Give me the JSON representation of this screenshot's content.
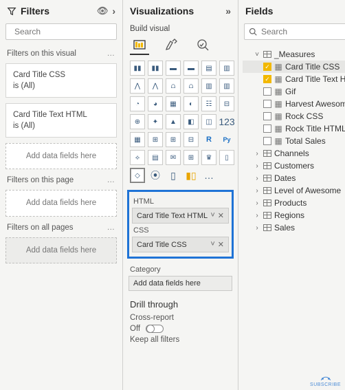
{
  "filters": {
    "title": "Filters",
    "search_placeholder": "Search",
    "sections": {
      "visual": {
        "label": "Filters on this visual",
        "cards": [
          {
            "name": "Card Title CSS",
            "summary": "is (All)"
          },
          {
            "name": "Card Title Text HTML",
            "summary": "is (All)"
          }
        ],
        "add_placeholder": "Add data fields here"
      },
      "page": {
        "label": "Filters on this page",
        "add_placeholder": "Add data fields here"
      },
      "all": {
        "label": "Filters on all pages",
        "add_placeholder": "Add data fields here"
      }
    }
  },
  "viz": {
    "title": "Visualizations",
    "build_label": "Build visual",
    "wells": {
      "html": {
        "label": "HTML",
        "field": "Card Title Text HTML"
      },
      "css": {
        "label": "CSS",
        "field": "Card Title CSS"
      },
      "category": {
        "label": "Category",
        "placeholder": "Add data fields here"
      }
    },
    "drill": {
      "title": "Drill through",
      "cross": "Cross-report",
      "off": "Off",
      "keep": "Keep all filters"
    }
  },
  "fields": {
    "title": "Fields",
    "search_placeholder": "Search",
    "measures_table": "_Measures",
    "measures": [
      {
        "name": "Card Title CSS",
        "checked": true,
        "selected": true
      },
      {
        "name": "Card Title Text H...",
        "checked": true,
        "selected": false
      },
      {
        "name": "Gif",
        "checked": false,
        "selected": false
      },
      {
        "name": "Harvest Awesome",
        "checked": false,
        "selected": false
      },
      {
        "name": "Rock CSS",
        "checked": false,
        "selected": false
      },
      {
        "name": "Rock Title HTML",
        "checked": false,
        "selected": false
      },
      {
        "name": "Total Sales",
        "checked": false,
        "selected": false
      }
    ],
    "tables": [
      "Channels",
      "Customers",
      "Dates",
      "Level of Awesome",
      "Products",
      "Regions",
      "Sales"
    ]
  },
  "subscribe": "SUBSCRIBE"
}
